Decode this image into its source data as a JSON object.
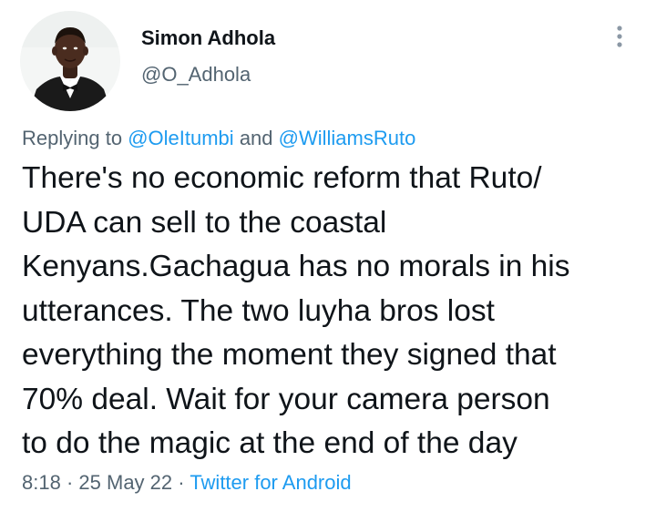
{
  "author": {
    "display_name": "Simon Adhola",
    "handle": "@O_Adhola",
    "avatar_icon": "profile-photo"
  },
  "more_icon": "more-vertical-icon",
  "reply": {
    "prefix": "Replying to",
    "mention_1": "@OleItumbi",
    "conjunction": "and",
    "mention_2": "@WilliamsRuto"
  },
  "tweet": {
    "lines": [
      "There's no economic reform that Ruto/",
      "UDA can sell to the coastal",
      "Kenyans.Gachagua has no morals in his",
      "utterances. The two luyha bros lost",
      "everything the moment they signed that",
      "70% deal. Wait for your camera person",
      "to do the magic at the end of the day"
    ]
  },
  "meta": {
    "time": "8:18",
    "separator": "·",
    "date": "25 May 22",
    "source": "Twitter for Android"
  },
  "colors": {
    "text": "#0f1419",
    "secondary": "#536471",
    "link": "#1d9bf0"
  }
}
